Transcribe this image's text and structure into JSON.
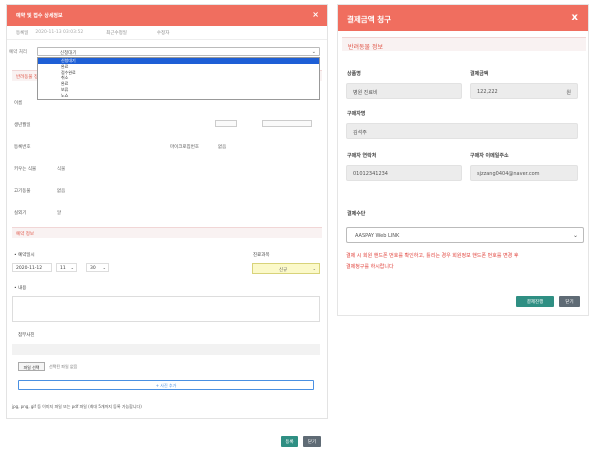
{
  "left_modal": {
    "title": "예약 및 접수 상세정보",
    "close_glyph": "×",
    "meta": {
      "reg_label": "등록일",
      "reg_value": "2020-11-13 03:03:52",
      "mod_label": "최근수정일",
      "mod_value": "",
      "editor_label": "수정자",
      "editor_value": ""
    },
    "status": {
      "label": "예약 처리",
      "selected": "신청대기",
      "options": [
        "신청대기",
        "완료",
        "접수완료",
        "취소",
        "완료",
        "보류",
        "노쇼"
      ],
      "active_index": 0
    },
    "patient_section": "반려동물 정보",
    "fields": {
      "name_label": "이름",
      "birth_label": "생년월일",
      "phone_label": "등록번호",
      "micro_label": "마이크로칩번호",
      "micro_value": "없음",
      "species_label": "키우는 식물",
      "species_value": "식물",
      "sex_label": "고기동물",
      "sex_value": "없음",
      "weight_label": "실외기",
      "weight_value": "알"
    },
    "reservation_section": "예약 정보",
    "reservation": {
      "date_label": "• 예약일시",
      "date_value": "2020-11-12",
      "hour_value": "11",
      "minute_value": "30",
      "dept_label": "진료과목",
      "dept_value": "신규",
      "content_label": "• 내용",
      "attach_label": "첨부사진",
      "file_button": "파일 선택",
      "file_none": "선택된 파일 없음",
      "add_file": "+ 사진 추가",
      "hint": "jpg, png, gif 등 이미지 파일 또는 pdf 파일 (최대 5개까지 등록 가능합니다)"
    },
    "buttons": {
      "save": "등록",
      "close": "닫기"
    }
  },
  "right_modal": {
    "title": "결제금액 청구",
    "close_glyph": "x",
    "section": "반려동물 정보",
    "product_label": "상품명",
    "product_value": "병원 진료비",
    "amount_label": "결제금액",
    "amount_value": "122,222",
    "amount_unit": "원",
    "buyer_label": "구매자명",
    "buyer_value": "김석주",
    "buyer_phone_label": "구매자 연락처",
    "buyer_phone_value": "01012341234",
    "buyer_email_label": "구매자 이메일주소",
    "buyer_email_value": "sjzzang0404@naver.com",
    "method_label": "결제수단",
    "method_value": "AASPAY Web LINK",
    "warning_line1": "결제 시 회원 핸드폰 번호를 확인하고, 틀리는 경우 회원정보 핸드폰 번호를 변경 후",
    "warning_line2": "결제청구를 하시랍니다",
    "buttons": {
      "pay": "결제진행",
      "close": "닫기"
    }
  },
  "colors": {
    "header": "#f06e5f",
    "accent_text": "#e0584a",
    "warning": "#e0413a",
    "teal_button": "#2f8f83",
    "grey_button": "#5f6b75",
    "dropdown_active": "#1e5fd6"
  }
}
